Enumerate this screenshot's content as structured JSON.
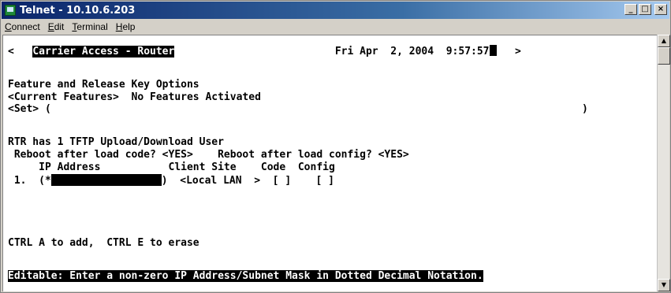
{
  "window": {
    "title": "Telnet - 10.10.6.203",
    "controls": {
      "minimize": "_",
      "maximize": "□",
      "close": "×"
    }
  },
  "menu": {
    "items": [
      {
        "underline": "C",
        "rest": "onnect"
      },
      {
        "underline": "E",
        "rest": "dit"
      },
      {
        "underline": "T",
        "rest": "erminal"
      },
      {
        "underline": "H",
        "rest": "elp"
      }
    ]
  },
  "terminal": {
    "header_left": "<",
    "header_title": "Carrier Access - Router",
    "header_date": "Fri Apr  2, 2004  9:57:57",
    "header_right": ">",
    "line_feature_title": "Feature and Release Key Options",
    "line_current_features": "<Current Features>  No Features Activated",
    "line_set_open": "<Set> (",
    "line_set_close": ")",
    "line_tftp_users": "RTR has 1 TFTP Upload/Download User",
    "line_reboot": " Reboot after load code? <YES>    Reboot after load config? <YES>",
    "line_columns": "     IP Address           Client Site    Code  Config",
    "row1_prefix": " 1.  (*",
    "row1_suffix": ")  <Local LAN  >  [ ]    [ ]",
    "line_ctrl": "CTRL A to add,  CTRL E to erase",
    "status_line": "Editable: Enter a non-zero IP Address/Subnet Mask in Dotted Decimal Notation."
  },
  "scrollbar": {
    "up_arrow": "▲",
    "down_arrow": "▼"
  }
}
